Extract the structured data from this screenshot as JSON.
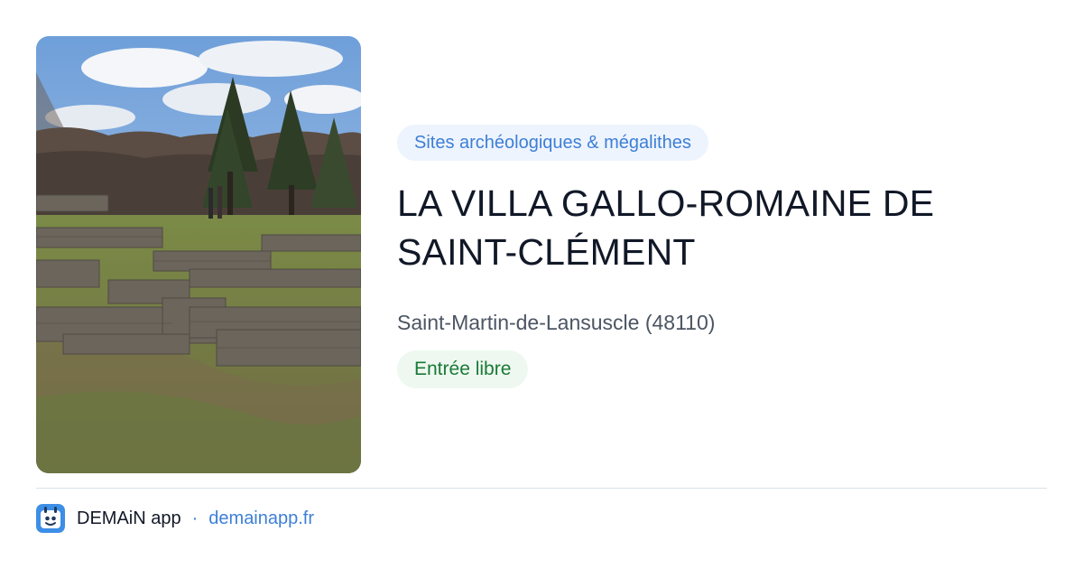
{
  "card": {
    "image": {
      "alt": "Ruines de murets en pierre sèche dans une clairière, forêt et ciel nuageux"
    },
    "category": "Sites archéologiques & mégalithes",
    "title_lines": [
      "LA VILLA GALLO-ROMAINE DE",
      "SAINT-CLÉMENT"
    ],
    "location": "Saint-Martin-de-Lansuscle (48110)",
    "access": "Entrée libre"
  },
  "footer": {
    "app_icon": "app-logo-icon",
    "app_name": "DEMAiN app",
    "separator": "·",
    "site": "demainapp.fr"
  },
  "colors": {
    "accent_blue": "#3d7fd6",
    "chip_blue_bg": "#eef4fd",
    "chip_green_text": "#1a7a36",
    "chip_green_bg": "#eef8f0",
    "divider": "#d8e3ea"
  }
}
